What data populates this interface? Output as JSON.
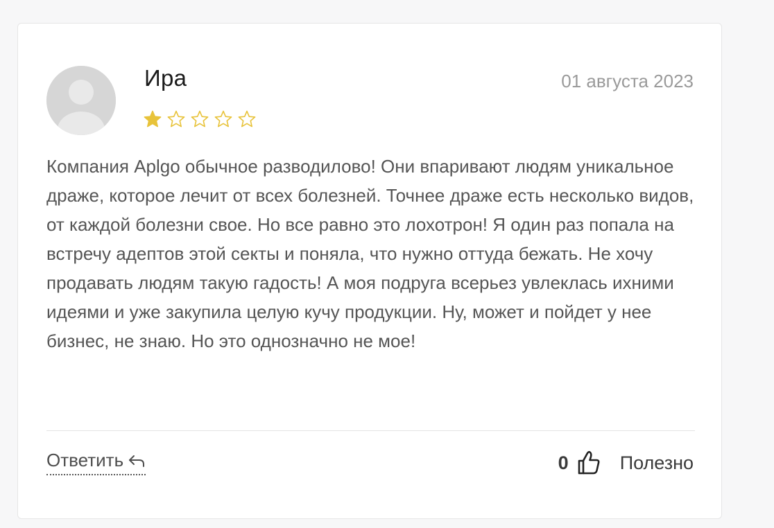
{
  "review": {
    "author": "Ира",
    "date": "01 августа 2023",
    "rating": 1,
    "rating_max": 5,
    "text": "Компания Aplgo обычное разводилово! Они впаривают людям уникальное драже, которое лечит от всех болезней. Точнее драже есть несколько видов, от каждой болезни свое. Но все равно это лохотрон! Я один раз попала на встречу адептов этой секты и поняла, что нужно оттуда бежать. Не хочу продавать людям такую гадость! А моя подруга всерьез увлеклась ихними идеями и уже закупила целую кучу продукции. Ну, может и пойдет у нее бизнес, не знаю. Но это однозначно не мое!"
  },
  "actions": {
    "reply_label": "Ответить",
    "helpful_count": "0",
    "helpful_label": "Полезно"
  },
  "colors": {
    "star_filled": "#e8c33a",
    "star_outline": "#e8c33a"
  },
  "icons": {
    "avatar": "user-avatar-placeholder",
    "reply": "reply-arrow-icon",
    "helpful": "thumbs-up-icon",
    "star": "star-icon"
  }
}
